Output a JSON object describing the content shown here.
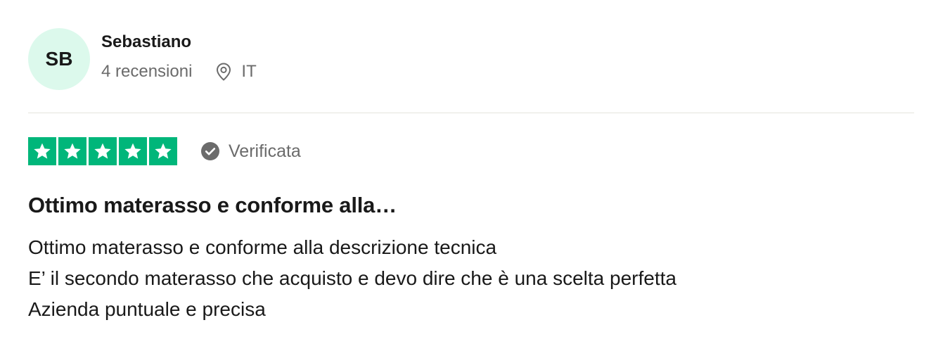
{
  "consumer": {
    "initials": "SB",
    "name": "Sebastiano",
    "review_count": "4 recensioni",
    "location_icon": "location-pin-icon",
    "country": "IT",
    "avatar_color": "#dcf9ec"
  },
  "review": {
    "rating": 5,
    "rating_max": 5,
    "star_color": "#00b67a",
    "verified_icon": "check-circle-icon",
    "verified_label": "Verificata",
    "title": "Ottimo materasso e conforme alla…",
    "body_lines": [
      "Ottimo materasso e conforme alla descrizione tecnica",
      "E’ il secondo materasso che acquisto e devo dire che è una scelta perfetta",
      "Azienda puntuale e precisa"
    ]
  }
}
